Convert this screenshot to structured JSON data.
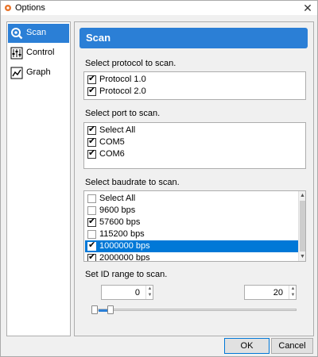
{
  "window": {
    "title": "Options",
    "close_glyph": "✕"
  },
  "sidebar": {
    "items": [
      {
        "label": "Scan",
        "icon": "scan-icon",
        "active": true
      },
      {
        "label": "Control",
        "icon": "control-icon",
        "active": false
      },
      {
        "label": "Graph",
        "icon": "graph-icon",
        "active": false
      }
    ]
  },
  "header": {
    "title": "Scan"
  },
  "protocol": {
    "label": "Select protocol to scan.",
    "options": [
      {
        "label": "Protocol 1.0",
        "checked": true
      },
      {
        "label": "Protocol 2.0",
        "checked": true
      }
    ]
  },
  "port": {
    "label": "Select port to scan.",
    "options": [
      {
        "label": "Select All",
        "checked": true
      },
      {
        "label": "COM5",
        "checked": true
      },
      {
        "label": "COM6",
        "checked": true
      }
    ]
  },
  "baudrate": {
    "label": "Select baudrate to scan.",
    "options": [
      {
        "label": "Select All",
        "checked": false
      },
      {
        "label": "9600 bps",
        "checked": false
      },
      {
        "label": "57600 bps",
        "checked": true
      },
      {
        "label": "115200 bps",
        "checked": false
      },
      {
        "label": "1000000 bps",
        "checked": true,
        "selected": true
      },
      {
        "label": "2000000 bps",
        "checked": true
      }
    ]
  },
  "id_range": {
    "label": "Set ID range to scan.",
    "min_value": "0",
    "max_value": "20"
  },
  "buttons": {
    "ok": "OK",
    "cancel": "Cancel"
  },
  "colors": {
    "accent": "#2b7fd6",
    "selection": "#0078d7"
  }
}
